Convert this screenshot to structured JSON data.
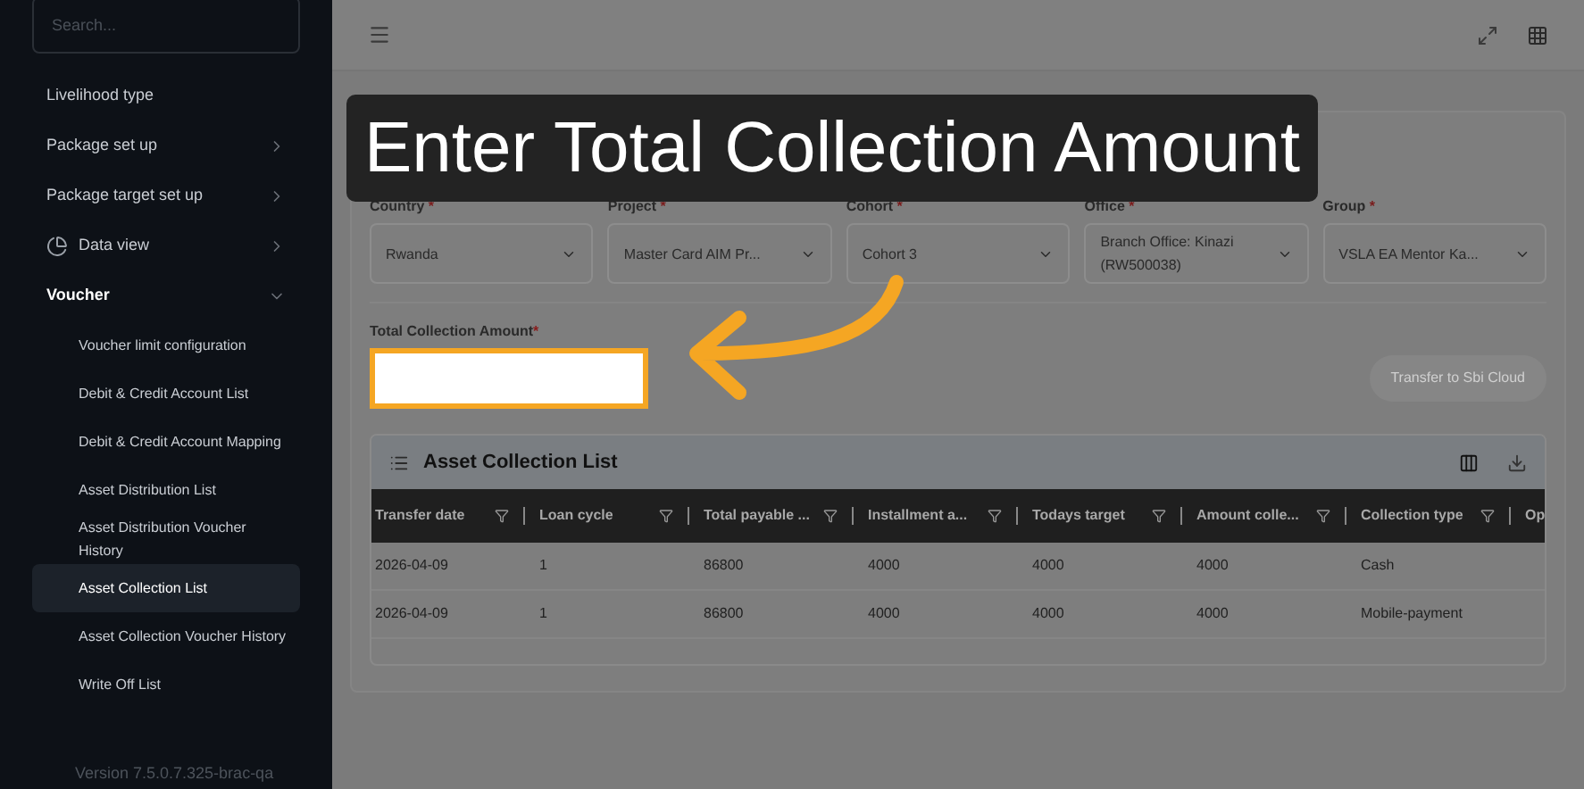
{
  "sidebar": {
    "search": {
      "placeholder": "Search..."
    },
    "items": [
      {
        "kind": "link",
        "label": "Livelihood type"
      },
      {
        "kind": "group",
        "label": "Package set up",
        "expanded": false
      },
      {
        "kind": "group",
        "label": "Package target set up",
        "expanded": false
      },
      {
        "kind": "chart_group",
        "label": "Data view",
        "expanded": false
      },
      {
        "kind": "group",
        "label": "Voucher",
        "expanded": true,
        "children": [
          {
            "label": "Voucher limit configuration",
            "selected": false
          },
          {
            "label": "Debit & Credit Account List",
            "selected": false
          },
          {
            "label": "Debit & Credit Account Mapping",
            "selected": false
          },
          {
            "label": "Asset Distribution List",
            "selected": false
          },
          {
            "label": "Asset Distribution Voucher History",
            "selected": false
          },
          {
            "label": "Asset Collection List",
            "selected": true
          },
          {
            "label": "Asset Collection Voucher History",
            "selected": false
          },
          {
            "label": "Write Off List",
            "selected": false
          }
        ]
      }
    ],
    "version": "Version 7.5.0.7.325-brac-qa"
  },
  "filters": [
    {
      "label": "Country",
      "required_mark": "*",
      "value": "Rwanda"
    },
    {
      "label": "Project",
      "required_mark": "*",
      "value": "Master Card AIM Pr..."
    },
    {
      "label": "Cohort",
      "required_mark": "*",
      "value": "Cohort 3"
    },
    {
      "label": "Office",
      "required_mark": "*",
      "value": "Branch Office: Kinazi (RW500038)"
    },
    {
      "label": "Group",
      "required_mark": "*",
      "value": "VSLA EA Mentor Ka..."
    }
  ],
  "amount_field": {
    "label": "Total Collection Amount",
    "required_mark": "*"
  },
  "transfer_button": {
    "label": "Transfer to Sbi Cloud",
    "disabled": true
  },
  "table": {
    "title": "Asset Collection List",
    "columns": [
      "Transfer date",
      "Loan cycle",
      "Total payable ...",
      "Installment a...",
      "Todays target",
      "Amount colle...",
      "Collection type",
      "Op"
    ],
    "rows": [
      [
        "2026-04-09",
        "1",
        "86800",
        "4000",
        "4000",
        "4000",
        "Cash"
      ],
      [
        "2026-04-09",
        "1",
        "86800",
        "4000",
        "4000",
        "4000",
        "Mobile-payment"
      ]
    ]
  },
  "callout": {
    "text": "Enter Total Collection Amount"
  }
}
